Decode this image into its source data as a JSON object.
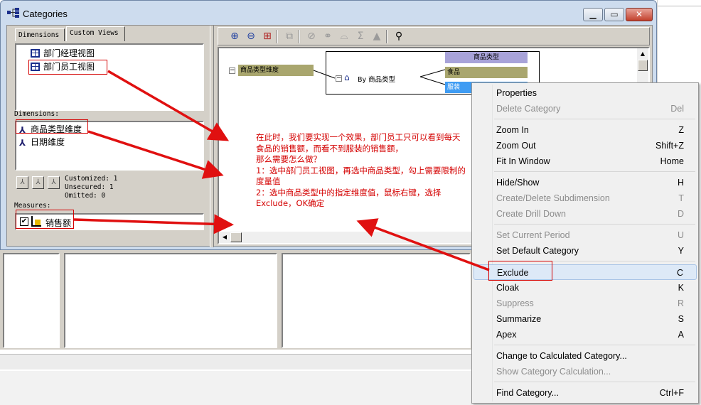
{
  "window": {
    "title": "Categories"
  },
  "left_panel": {
    "tabs": [
      {
        "label": "Dimensions"
      },
      {
        "label": "Custom Views"
      }
    ],
    "views": [
      {
        "label": "部门经理视图"
      },
      {
        "label": "部门员工视图"
      }
    ],
    "dimensions_label": "Dimensions:",
    "dimensions": [
      {
        "label": "商品类型维度"
      },
      {
        "label": "日期维度"
      }
    ],
    "stats": {
      "customized": "Customized: 1",
      "unsecured": "Unsecured: 1",
      "omitted": "Omitted: 0"
    },
    "measures_label": "Measures:",
    "measures": [
      {
        "label": "销售额",
        "checked": true
      }
    ]
  },
  "toolbar": {
    "icons": [
      "zoom-in-icon",
      "zoom-out-icon",
      "fit-window-icon",
      "copy-icon",
      "exclude-icon",
      "cloak-icon",
      "suppress-icon",
      "summarize-icon",
      "apex-icon",
      "find-icon"
    ]
  },
  "diagram": {
    "dimension_node": "商品类型维度",
    "category_node": "By 商品类型",
    "level_header": "商品类型",
    "children": [
      {
        "label": "食品"
      },
      {
        "label": "服装"
      }
    ]
  },
  "annotation": {
    "lines": [
      "在此时，我们要实现一个效果，部门员工只可以看到每天",
      "食品的销售额，而看不到服装的销售额，",
      "那么需要怎么做？",
      "1：选中部门员工视图，再选中商品类型，勾上需要限制的",
      "度量值",
      "2：选中商品类型中的指定维度值，鼠标右键，选择",
      "Exclude，OK确定"
    ],
    "color": "#d40000"
  },
  "context_menu": {
    "items": [
      {
        "label": "Properties",
        "key": "",
        "enabled": true
      },
      {
        "label": "Delete Category",
        "key": "Del",
        "enabled": false
      },
      {
        "label": "Zoom In",
        "key": "Z",
        "enabled": true
      },
      {
        "label": "Zoom Out",
        "key": "Shift+Z",
        "enabled": true
      },
      {
        "label": "Fit In Window",
        "key": "Home",
        "enabled": true
      },
      {
        "label": "Hide/Show",
        "key": "H",
        "enabled": true
      },
      {
        "label": "Create/Delete Subdimension",
        "key": "T",
        "enabled": false
      },
      {
        "label": "Create Drill Down",
        "key": "D",
        "enabled": false
      },
      {
        "label": "Set Current Period",
        "key": "U",
        "enabled": false
      },
      {
        "label": "Set Default Category",
        "key": "Y",
        "enabled": true
      },
      {
        "label": "Exclude",
        "key": "C",
        "enabled": true,
        "highlighted": true
      },
      {
        "label": "Cloak",
        "key": "K",
        "enabled": true
      },
      {
        "label": "Suppress",
        "key": "R",
        "enabled": false
      },
      {
        "label": "Summarize",
        "key": "S",
        "enabled": true
      },
      {
        "label": "Apex",
        "key": "A",
        "enabled": true
      },
      {
        "label": "Change to Calculated Category...",
        "key": "",
        "enabled": true
      },
      {
        "label": "Show Category Calculation...",
        "key": "",
        "enabled": false
      },
      {
        "label": "Find Category...",
        "key": "Ctrl+F",
        "enabled": true
      }
    ]
  }
}
